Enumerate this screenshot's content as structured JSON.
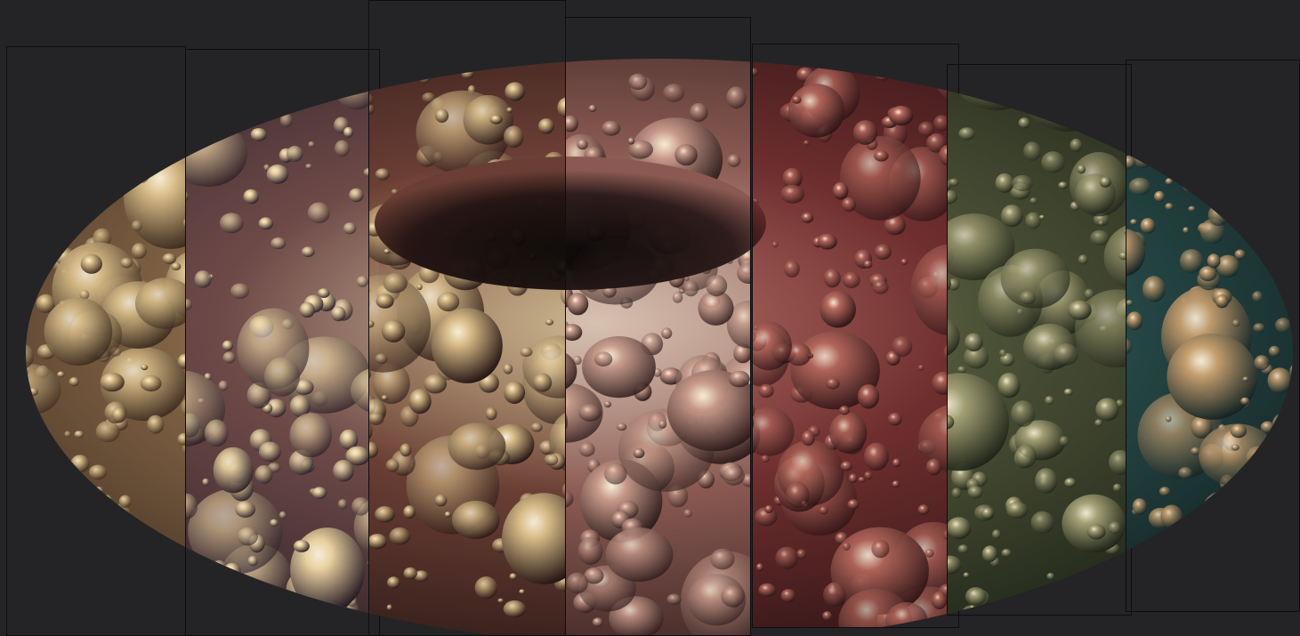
{
  "scene": {
    "subject": "torus",
    "background_color": "#242426",
    "panel_border_color": "#0e0e10"
  },
  "panels": [
    {
      "id": "panel-1",
      "palette": {
        "base": "#8a6a4a",
        "light": "#e8d2a4",
        "dark": "#3a2a1e",
        "blister": "#dcc08a"
      }
    },
    {
      "id": "panel-2",
      "palette": {
        "base": "#6e4a48",
        "light": "#f0d8b0",
        "dark": "#2a1e26",
        "blister": "#e8d0a0"
      }
    },
    {
      "id": "panel-3",
      "palette": {
        "base": "#6a3e34",
        "light": "#e8cfa0",
        "dark": "#261614",
        "blister": "#d8bc88"
      }
    },
    {
      "id": "panel-4",
      "palette": {
        "base": "#8a5a52",
        "light": "#f6dcc8",
        "dark": "#2e1c1c",
        "blister": "#c89a8a"
      }
    },
    {
      "id": "panel-5",
      "palette": {
        "base": "#6e2e2e",
        "light": "#c87a70",
        "dark": "#2a1214",
        "blister": "#b86a5e"
      }
    },
    {
      "id": "panel-6",
      "palette": {
        "base": "#4e5438",
        "light": "#c8c49a",
        "dark": "#1e2418",
        "blister": "#a8a478"
      }
    },
    {
      "id": "panel-7",
      "palette": {
        "base": "#2e5a58",
        "light": "#7aa08a",
        "dark": "#142424",
        "blister": "#c8a070"
      }
    }
  ]
}
